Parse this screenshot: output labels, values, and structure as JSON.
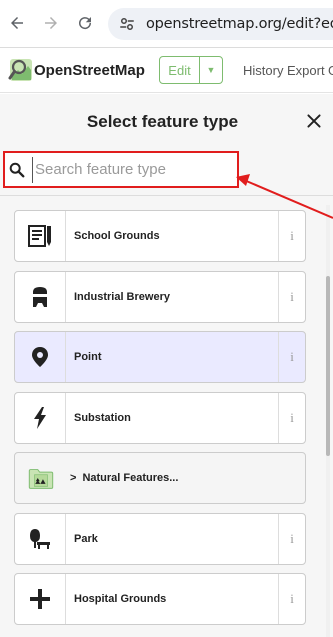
{
  "browser": {
    "url": "openstreetmap.org/edit?editor=i"
  },
  "header": {
    "brand": "OpenStreetMap",
    "edit_label": "Edit",
    "links": [
      "History",
      "Export",
      "G"
    ]
  },
  "panel": {
    "title": "Select feature type",
    "search": {
      "placeholder": "Search feature type",
      "value": ""
    }
  },
  "presets": [
    {
      "label": "School Grounds",
      "icon": "school-icon",
      "selected": false,
      "info": "i"
    },
    {
      "label": "Industrial Brewery",
      "icon": "brewery-icon",
      "selected": false,
      "info": "i"
    },
    {
      "label": "Point",
      "icon": "point-marker-icon",
      "selected": true,
      "info": "i"
    },
    {
      "label": "Substation",
      "icon": "lightning-icon",
      "selected": false,
      "info": "i"
    },
    {
      "label": "Natural Features...",
      "icon": "natural-folder-icon",
      "category": true,
      "chevron": ">"
    },
    {
      "label": "Park",
      "icon": "park-bench-icon",
      "selected": false,
      "info": "i"
    },
    {
      "label": "Hospital Grounds",
      "icon": "hospital-cross-icon",
      "selected": false,
      "info": "i"
    }
  ],
  "colors": {
    "osm_green": "#7ebc6f",
    "highlight_red": "#e11d1d",
    "selected_bg": "#eaeaff"
  }
}
